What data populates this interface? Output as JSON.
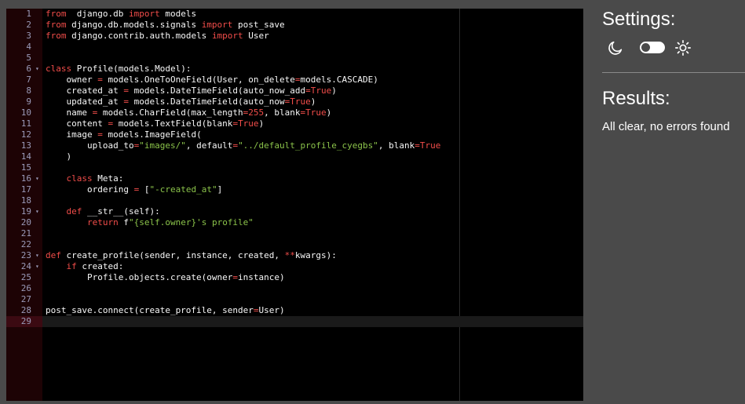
{
  "editor": {
    "active_line": 29,
    "fold_lines": [
      6,
      16,
      19,
      23,
      24
    ],
    "lines": [
      [
        [
          "kw",
          "from"
        ],
        [
          "",
          "  django.db "
        ],
        [
          "kw",
          "import"
        ],
        [
          "",
          " models"
        ]
      ],
      [
        [
          "kw",
          "from"
        ],
        [
          "",
          " django.db.models.signals "
        ],
        [
          "kw",
          "import"
        ],
        [
          "",
          " post_save"
        ]
      ],
      [
        [
          "kw",
          "from"
        ],
        [
          "",
          " django.contrib.auth.models "
        ],
        [
          "kw",
          "import"
        ],
        [
          "",
          " User"
        ]
      ],
      [],
      [],
      [
        [
          "kw",
          "class"
        ],
        [
          "",
          " Profile(models.Model):"
        ]
      ],
      [
        [
          "",
          "    owner "
        ],
        [
          "op",
          "="
        ],
        [
          "",
          " models.OneToOneField(User, on_delete"
        ],
        [
          "op",
          "="
        ],
        [
          "",
          "models.CASCADE)"
        ]
      ],
      [
        [
          "",
          "    created_at "
        ],
        [
          "op",
          "="
        ],
        [
          "",
          " models.DateTimeField(auto_now_add"
        ],
        [
          "op",
          "="
        ],
        [
          "kw",
          "True"
        ],
        [
          "",
          ")"
        ]
      ],
      [
        [
          "",
          "    updated_at "
        ],
        [
          "op",
          "="
        ],
        [
          "",
          " models.DateTimeField(auto_now"
        ],
        [
          "op",
          "="
        ],
        [
          "kw",
          "True"
        ],
        [
          "",
          ")"
        ]
      ],
      [
        [
          "",
          "    name "
        ],
        [
          "op",
          "="
        ],
        [
          "",
          " models.CharField(max_length"
        ],
        [
          "op",
          "="
        ],
        [
          "kw",
          "255"
        ],
        [
          "",
          ", blank"
        ],
        [
          "op",
          "="
        ],
        [
          "kw",
          "True"
        ],
        [
          "",
          ")"
        ]
      ],
      [
        [
          "",
          "    content "
        ],
        [
          "op",
          "="
        ],
        [
          "",
          " models.TextField(blank"
        ],
        [
          "op",
          "="
        ],
        [
          "kw",
          "True"
        ],
        [
          "",
          ")"
        ]
      ],
      [
        [
          "",
          "    image "
        ],
        [
          "op",
          "="
        ],
        [
          "",
          " models.ImageField("
        ]
      ],
      [
        [
          "",
          "        upload_to"
        ],
        [
          "op",
          "="
        ],
        [
          "str",
          "\"images/\""
        ],
        [
          "",
          ", default"
        ],
        [
          "op",
          "="
        ],
        [
          "str",
          "\"../default_profile_cyegbs\""
        ],
        [
          "",
          ", blank"
        ],
        [
          "op",
          "="
        ],
        [
          "kw",
          "True"
        ]
      ],
      [
        [
          "",
          "    )"
        ]
      ],
      [],
      [
        [
          "",
          "    "
        ],
        [
          "kw",
          "class"
        ],
        [
          "",
          " Meta:"
        ]
      ],
      [
        [
          "",
          "        ordering "
        ],
        [
          "op",
          "="
        ],
        [
          "",
          " ["
        ],
        [
          "str",
          "\"-created_at\""
        ],
        [
          "",
          "]"
        ]
      ],
      [],
      [
        [
          "",
          "    "
        ],
        [
          "kw",
          "def"
        ],
        [
          "",
          " __str__(self):"
        ]
      ],
      [
        [
          "",
          "        "
        ],
        [
          "kw",
          "return"
        ],
        [
          "",
          " f"
        ],
        [
          "str",
          "\"{self.owner}'s profile\""
        ]
      ],
      [],
      [],
      [
        [
          "kw",
          "def"
        ],
        [
          "",
          " create_profile(sender, instance, created, "
        ],
        [
          "op",
          "**"
        ],
        [
          "",
          "kwargs):"
        ]
      ],
      [
        [
          "",
          "    "
        ],
        [
          "kw",
          "if"
        ],
        [
          "",
          " created:"
        ]
      ],
      [
        [
          "",
          "        Profile.objects.create(owner"
        ],
        [
          "op",
          "="
        ],
        [
          "",
          "instance)"
        ]
      ],
      [],
      [],
      [
        [
          "",
          "post_save.connect(create_profile, sender"
        ],
        [
          "op",
          "="
        ],
        [
          "",
          "User)"
        ]
      ],
      []
    ]
  },
  "settings": {
    "title": "Settings:",
    "dark_mode_icon": "moon-icon",
    "light_mode_icon": "sun-icon",
    "toggle_state": "off"
  },
  "results": {
    "title": "Results:",
    "message": "All clear, no errors found"
  },
  "colors": {
    "background": "#4a4a4a",
    "editor_bg": "#000000",
    "gutter_bg": "#1d0305",
    "keyword": "#f24d4a",
    "string": "#8bc34a",
    "text": "#f8f8f8"
  }
}
